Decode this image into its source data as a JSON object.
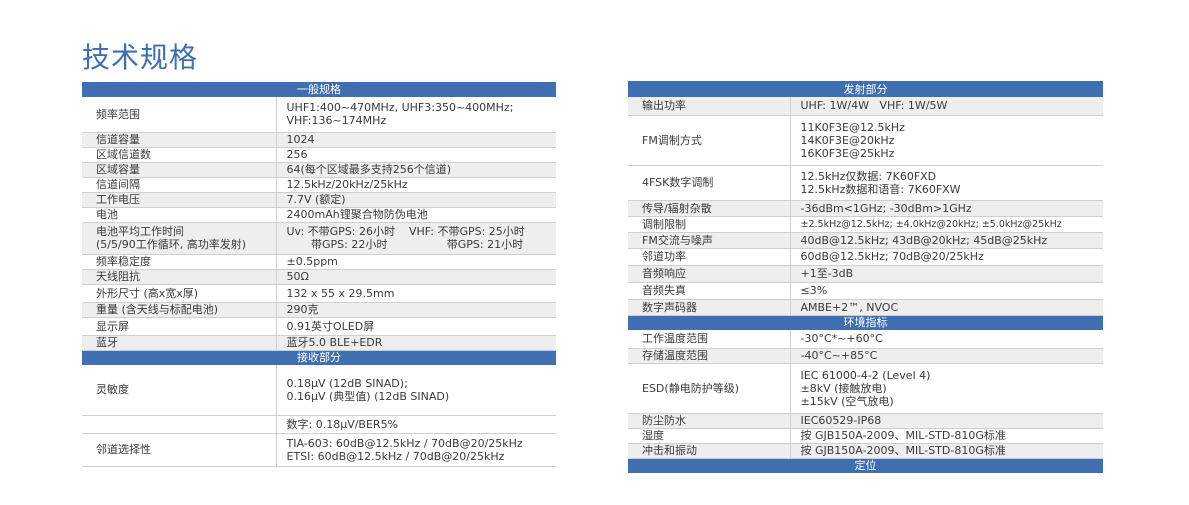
{
  "page": {
    "title": "技术规格"
  },
  "left_table": {
    "rows": [
      {
        "type": "header",
        "text": "一般规格",
        "h": 15
      },
      {
        "type": "row",
        "shade": "white",
        "h": 35,
        "label": [
          "频率范围"
        ],
        "value": [
          "UHF1:400~470MHz, UHF3:350~400MHz;",
          "VHF:136~174MHz"
        ]
      },
      {
        "type": "row",
        "shade": "grey",
        "h": 15,
        "label": [
          "信道容量"
        ],
        "value": [
          "1024"
        ]
      },
      {
        "type": "row",
        "shade": "white",
        "h": 15,
        "label": [
          "区域信道数"
        ],
        "value": [
          "256"
        ]
      },
      {
        "type": "row",
        "shade": "grey",
        "h": 15,
        "label": [
          "区域容量"
        ],
        "value": [
          "64(每个区域最多支持256个信道)"
        ]
      },
      {
        "type": "row",
        "shade": "white",
        "h": 15,
        "label": [
          "信道间隔"
        ],
        "value": [
          "12.5kHz/20kHz/25kHz"
        ]
      },
      {
        "type": "row",
        "shade": "grey",
        "h": 15,
        "label": [
          "工作电压"
        ],
        "value": [
          "7.7V (额定)"
        ]
      },
      {
        "type": "row",
        "shade": "white",
        "h": 15,
        "label": [
          "电池"
        ],
        "value": [
          "2400mAh锂聚合物防伪电池"
        ]
      },
      {
        "type": "row",
        "shade": "grey",
        "h": 32,
        "label": [
          "电池平均工作时间",
          "(5/5/90工作循环, 高功率发射)"
        ],
        "value": [
          "Uv: 不带GPS: 26小时    VHF: 不带GPS: 25小时",
          "       带GPS: 22小时                 带GPS: 21小时"
        ]
      },
      {
        "type": "row",
        "shade": "white",
        "h": 15,
        "label": [
          "频率稳定度"
        ],
        "value": [
          "±0.5ppm"
        ]
      },
      {
        "type": "row",
        "shade": "grey",
        "h": 15,
        "label": [
          "天线阻抗"
        ],
        "value": [
          "50Ω"
        ]
      },
      {
        "type": "row",
        "shade": "white",
        "h": 18,
        "label": [
          "外形尺寸 (高x宽x厚)"
        ],
        "value": [
          "132 x 55 x 29.5mm"
        ]
      },
      {
        "type": "row",
        "shade": "grey",
        "h": 15,
        "label": [
          "重量 (含天线与标配电池)"
        ],
        "value": [
          "290克"
        ]
      },
      {
        "type": "row",
        "shade": "white",
        "h": 18,
        "label": [
          "显示屏"
        ],
        "value": [
          "0.91英寸OLED屏"
        ]
      },
      {
        "type": "row",
        "shade": "grey",
        "h": 15,
        "label": [
          "蓝牙"
        ],
        "value": [
          "蓝牙5.0 BLE+EDR"
        ]
      },
      {
        "type": "header",
        "text": "接收部分",
        "h": 15
      },
      {
        "type": "row",
        "shade": "white",
        "h": 50,
        "label": [
          "灵敏度"
        ],
        "value": [
          "0.18μV (12dB SINAD);",
          "0.16μV (典型值) (12dB SINAD)"
        ]
      },
      {
        "type": "row",
        "shade": "white",
        "h": 18,
        "label": [
          ""
        ],
        "value": [
          "数字: 0.18μV/BER5%"
        ]
      },
      {
        "type": "row",
        "shade": "white",
        "h": 33,
        "label": [
          "邻道选择性"
        ],
        "value": [
          "TIA-603: 60dB@12.5kHz / 70dB@20/25kHz",
          "ETSI: 60dB@12.5kHz / 70dB@20/25kHz"
        ]
      }
    ]
  },
  "right_table": {
    "rows": [
      {
        "type": "header",
        "text": "发射部分",
        "h": 16
      },
      {
        "type": "row",
        "shade": "grey",
        "h": 18,
        "label": [
          "输出功率"
        ],
        "value": [
          "UHF: 1W/4W   VHF: 1W/5W"
        ]
      },
      {
        "type": "row",
        "shade": "white",
        "h": 50,
        "label": [
          "FM调制方式"
        ],
        "value": [
          "11K0F3E@12.5kHz",
          "14K0F3E@20kHz",
          "16K0F3E@25kHz"
        ]
      },
      {
        "type": "row",
        "shade": "white",
        "h": 35,
        "label": [
          "4FSK数字调制"
        ],
        "value": [
          "12.5kHz仅数据: 7K60FXD",
          "12.5kHz数据和语音: 7K60FXW"
        ]
      },
      {
        "type": "row",
        "shade": "grey",
        "h": 16,
        "label": [
          "传导/辐射杂散"
        ],
        "value": [
          "-36dBm<1GHz; -30dBm>1GHz"
        ]
      },
      {
        "type": "row",
        "shade": "white",
        "h": 16,
        "label": [
          "调制限制"
        ],
        "value": [
          "±2.5kHz@12.5kHz; ±4.0kHz@20kHz; ±5.0kHz@25kHz"
        ],
        "small": true
      },
      {
        "type": "row",
        "shade": "grey",
        "h": 16,
        "label": [
          "FM交流与噪声"
        ],
        "value": [
          "40dB@12.5kHz; 43dB@20kHz; 45dB@25kHz"
        ]
      },
      {
        "type": "row",
        "shade": "white",
        "h": 17,
        "label": [
          "邻道功率"
        ],
        "value": [
          "60dB@12.5kHz; 70dB@20/25kHz"
        ]
      },
      {
        "type": "row",
        "shade": "grey",
        "h": 17,
        "label": [
          "音频响应"
        ],
        "value": [
          "+1至-3dB"
        ]
      },
      {
        "type": "row",
        "shade": "white",
        "h": 17,
        "label": [
          "音频失真"
        ],
        "value": [
          "≤3%"
        ]
      },
      {
        "type": "row",
        "shade": "grey",
        "h": 16,
        "label": [
          "数字声码器"
        ],
        "value": [
          "AMBE+2™, NVOC"
        ]
      },
      {
        "type": "header",
        "text": "环境指标",
        "h": 15
      },
      {
        "type": "row",
        "shade": "white",
        "h": 18,
        "label": [
          "工作温度范围"
        ],
        "value": [
          "-30°C*~+60°C"
        ]
      },
      {
        "type": "row",
        "shade": "grey",
        "h": 15,
        "label": [
          "存储温度范围"
        ],
        "value": [
          "-40°C~+85°C"
        ]
      },
      {
        "type": "row",
        "shade": "white",
        "h": 50,
        "label": [
          "ESD(静电防护等级)"
        ],
        "value": [
          "IEC 61000-4-2 (Level 4)",
          "±8kV (接触放电)",
          "±15kV (空气放电)"
        ]
      },
      {
        "type": "row",
        "shade": "grey",
        "h": 15,
        "label": [
          "防尘防水"
        ],
        "value": [
          "IEC60529-IP68"
        ]
      },
      {
        "type": "row",
        "shade": "white",
        "h": 15,
        "label": [
          "湿度"
        ],
        "value": [
          "按 GJB150A-2009、MIL-STD-810G标准"
        ]
      },
      {
        "type": "row",
        "shade": "grey",
        "h": 15,
        "label": [
          "冲击和振动"
        ],
        "value": [
          "按 GJB150A-2009、MIL-STD-810G标准"
        ]
      },
      {
        "type": "header",
        "text": "定位",
        "h": 15
      }
    ]
  }
}
